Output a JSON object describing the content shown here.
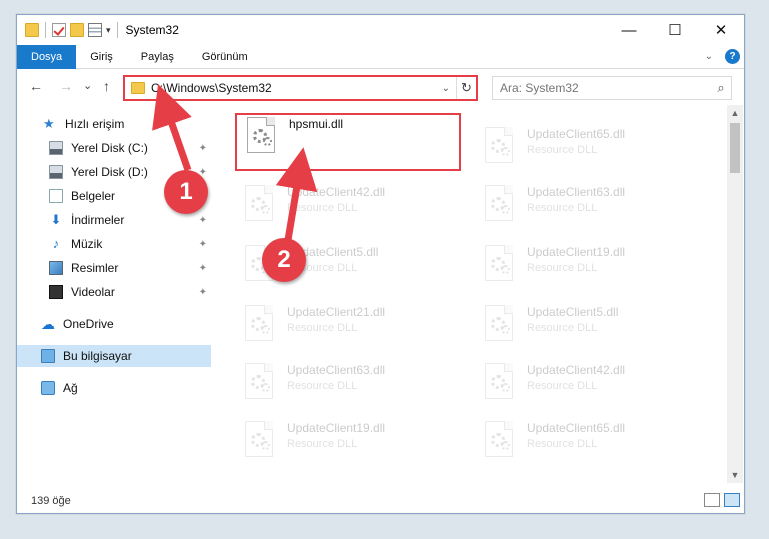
{
  "window": {
    "title": "System32",
    "controls": [
      "—",
      "☐",
      "✕"
    ]
  },
  "ribbon": {
    "tabs": [
      {
        "label": "Dosya",
        "active": true
      },
      {
        "label": "Giriş",
        "active": false
      },
      {
        "label": "Paylaş",
        "active": false
      },
      {
        "label": "Görünüm",
        "active": false
      }
    ],
    "help": "?"
  },
  "address": {
    "path": "C:\\Windows\\System32",
    "back": "←",
    "forward": "→",
    "recent": "⌄",
    "up": "↑",
    "refresh": "↻",
    "dropdown": "⌄"
  },
  "search": {
    "placeholder": "Ara: System32",
    "icon": "⌕"
  },
  "nav": {
    "items": [
      {
        "label": "Hızlı erişim",
        "icon": "star-icon",
        "pinned": false
      },
      {
        "label": "Yerel Disk (C:)",
        "icon": "drive-icon",
        "pinned": true
      },
      {
        "label": "Yerel Disk (D:)",
        "icon": "drive-icon",
        "pinned": true
      },
      {
        "label": "Belgeler",
        "icon": "document-icon",
        "pinned": true
      },
      {
        "label": "İndirmeler",
        "icon": "download-icon",
        "pinned": true
      },
      {
        "label": "Müzik",
        "icon": "music-icon",
        "pinned": true
      },
      {
        "label": "Resimler",
        "icon": "pictures-icon",
        "pinned": true
      },
      {
        "label": "Videolar",
        "icon": "videos-icon",
        "pinned": true
      },
      {
        "label": "OneDrive",
        "icon": "cloud-icon",
        "pinned": false
      },
      {
        "label": "Bu bilgisayar",
        "icon": "computer-icon",
        "pinned": false,
        "selected": true
      },
      {
        "label": "Ağ",
        "icon": "network-icon",
        "pinned": false
      }
    ],
    "pin_glyph": "📌"
  },
  "files": {
    "selected": {
      "name": "hpsmui.dll",
      "desc": ""
    },
    "left_column": [
      {
        "name": "UpdateClient42.dll",
        "desc": "Resource DLL"
      },
      {
        "name": "UpdateClient5.dll",
        "desc": "Resource DLL"
      },
      {
        "name": "UpdateClient21.dll",
        "desc": "Resource DLL"
      },
      {
        "name": "UpdateClient63.dll",
        "desc": "Resource DLL"
      },
      {
        "name": "UpdateClient19.dll",
        "desc": "Resource DLL"
      }
    ],
    "right_column": [
      {
        "name": "UpdateClient65.dll",
        "desc": "Resource DLL"
      },
      {
        "name": "UpdateClient63.dll",
        "desc": "Resource DLL"
      },
      {
        "name": "UpdateClient19.dll",
        "desc": "Resource DLL"
      },
      {
        "name": "UpdateClient5.dll",
        "desc": "Resource DLL"
      },
      {
        "name": "UpdateClient42.dll",
        "desc": "Resource DLL"
      },
      {
        "name": "UpdateClient65.dll",
        "desc": "Resource DLL"
      }
    ]
  },
  "status": {
    "count": "139 öğe"
  },
  "annotations": {
    "badge_1": "1",
    "badge_2": "2",
    "color": "#e53e46"
  }
}
